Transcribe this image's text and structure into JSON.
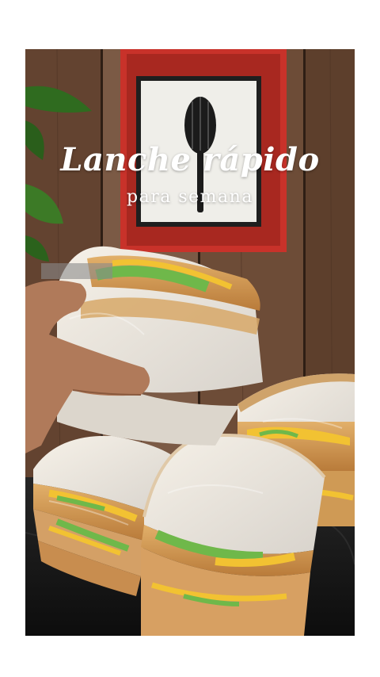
{
  "caption": {
    "title": "Lanche rápido",
    "subtitle": "para semana"
  },
  "scene": {
    "subject": "wrapped-sandwiches",
    "props": [
      "whisk-frame-icon",
      "plant-leaves",
      "hand"
    ],
    "colors": {
      "wood": "#6b4a35",
      "frame_red": "#c8322a",
      "bread_crust": "#d9a25a",
      "bread_crumb": "#efe7da",
      "lettuce": "#6fb84a",
      "egg": "#f2c232",
      "counter": "#1a1a1a"
    }
  }
}
